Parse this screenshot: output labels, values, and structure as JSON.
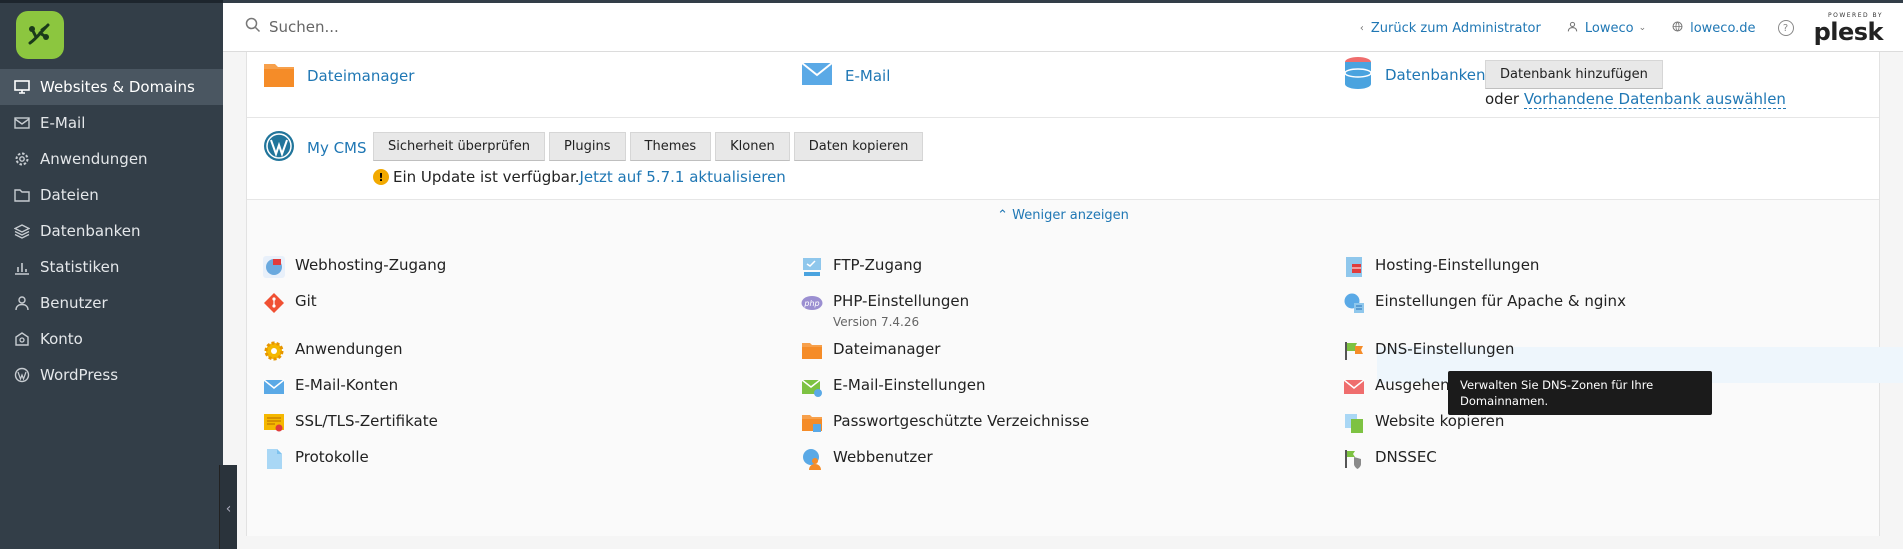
{
  "topbar": {
    "search_placeholder": "Suchen...",
    "back_label": "Zurück zum Administrator",
    "user_label": "Loweco",
    "domain_label": "loweco.de",
    "help_label": "?",
    "powered_by": "POWERED BY",
    "plesk": "plesk"
  },
  "sidebar": {
    "items": [
      {
        "label": "Websites & Domains",
        "icon": "monitor-icon",
        "active": true
      },
      {
        "label": "E-Mail",
        "icon": "mail-icon"
      },
      {
        "label": "Anwendungen",
        "icon": "gear-icon"
      },
      {
        "label": "Dateien",
        "icon": "folder-icon"
      },
      {
        "label": "Datenbanken",
        "icon": "layers-icon"
      },
      {
        "label": "Statistiken",
        "icon": "bar-chart-icon"
      },
      {
        "label": "Benutzer",
        "icon": "user-icon"
      },
      {
        "label": "Konto",
        "icon": "account-icon"
      },
      {
        "label": "WordPress",
        "icon": "wordpress-icon"
      }
    ]
  },
  "top_links": {
    "filemanager": "Dateimanager",
    "email": "E-Mail",
    "databases": "Datenbanken",
    "add_db_button": "Datenbank hinzufügen",
    "or_text": "oder",
    "select_db_link": "Vorhandene Datenbank auswählen"
  },
  "cms": {
    "name": "My CMS",
    "buttons": [
      "Sicherheit überprüfen",
      "Plugins",
      "Themes",
      "Klonen",
      "Daten kopieren"
    ],
    "update_text": "Ein Update ist verfügbar.",
    "update_link": "Jetzt auf 5.7.1 aktualisieren"
  },
  "less_link": "Weniger anzeigen",
  "tools": {
    "col1": [
      "Webhosting-Zugang",
      "Git",
      "Anwendungen",
      "E-Mail-Konten",
      "SSL/TLS-Zertifikate",
      "Protokolle"
    ],
    "col2": [
      "FTP-Zugang",
      "PHP-Einstellungen",
      "Dateimanager",
      "E-Mail-Einstellungen",
      "Passwortgeschützte Verzeichnisse",
      "Webbenutzer"
    ],
    "col2_php_version": "Version 7.4.26",
    "col3": [
      "Hosting-Einstellungen",
      "Einstellungen für Apache & nginx",
      "DNS-Einstellungen",
      "Ausgehende",
      "Website kopieren",
      "DNSSEC"
    ]
  },
  "tooltip": "Verwalten Sie DNS-Zonen für Ihre Domainnamen.",
  "colors": {
    "sidebar_bg": "#333e48",
    "link": "#1f77b4",
    "accent_green": "#8cc63f"
  }
}
